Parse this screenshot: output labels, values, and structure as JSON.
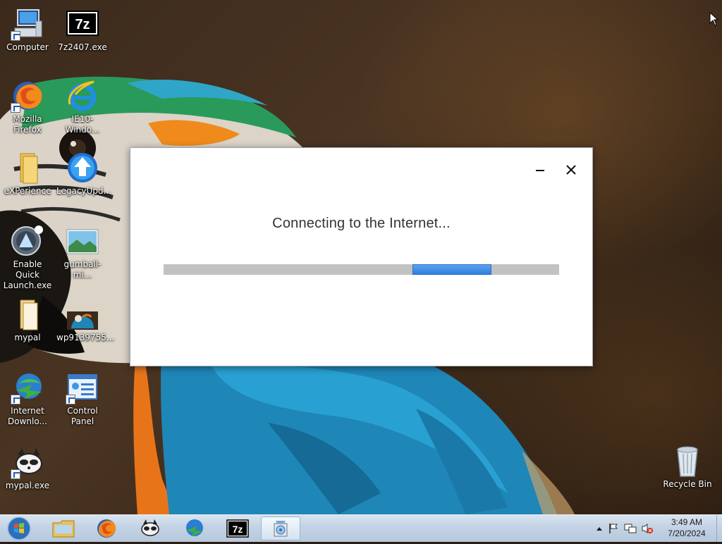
{
  "desktop": {
    "icons": [
      {
        "label": "Computer",
        "icon": "computer-icon"
      },
      {
        "label": "7z2407.exe",
        "icon": "7zip-icon"
      },
      {
        "label": "Mozilla Firefox",
        "icon": "firefox-icon"
      },
      {
        "label": "IE10-Windo...",
        "icon": "internet-explorer-icon"
      },
      {
        "label": "eXPerience",
        "icon": "folder-icon"
      },
      {
        "label": "LegacyUpd...",
        "icon": "legacy-update-icon"
      },
      {
        "label": "Enable Quick Launch.exe",
        "icon": "quick-launch-icon"
      },
      {
        "label": "gumball-mi...",
        "icon": "image-file-icon"
      },
      {
        "label": "mypal",
        "icon": "folder-icon"
      },
      {
        "label": "wp9139755...",
        "icon": "image-file-icon"
      },
      {
        "label": "Internet Downlo...",
        "icon": "internet-download-manager-icon"
      },
      {
        "label": "Control Panel",
        "icon": "control-panel-icon"
      },
      {
        "label": "mypal.exe",
        "icon": "mypal-icon"
      },
      {
        "label": "Recycle Bin",
        "icon": "recycle-bin-icon"
      }
    ]
  },
  "dialog": {
    "message": "Connecting to the Internet...",
    "progress_indeterminate": true,
    "minimize_icon": "minimize-icon",
    "close_icon": "close-icon"
  },
  "taskbar": {
    "start_icon": "windows-start-icon",
    "items": [
      {
        "name": "file-explorer",
        "icon": "folder-icon"
      },
      {
        "name": "firefox",
        "icon": "firefox-icon"
      },
      {
        "name": "mypal",
        "icon": "mypal-icon"
      },
      {
        "name": "internet-download-manager",
        "icon": "internet-download-manager-icon"
      },
      {
        "name": "7zip",
        "icon": "7zip-icon"
      },
      {
        "name": "setup",
        "icon": "setup-icon",
        "active": true
      }
    ],
    "tray": {
      "icons": [
        "show-hidden-icons-icon",
        "action-center-flag-icon",
        "network-icon",
        "volume-muted-icon"
      ],
      "time": "3:49 AM",
      "date": "7/20/2024"
    }
  },
  "colors": {
    "taskbar": "#c3d3e5",
    "progress_track": "#c2c2c2",
    "progress_fill": "#3a8ae6",
    "dialog_bg": "#ffffff"
  }
}
